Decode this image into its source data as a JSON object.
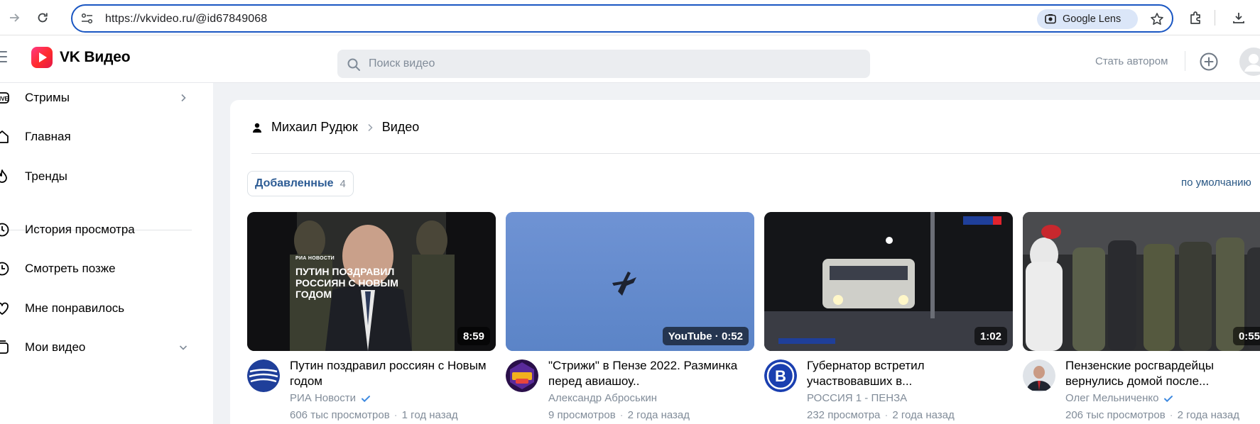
{
  "browser": {
    "url": "https://vkvideo.ru/@id67849068",
    "lens_label": "Google Lens",
    "icons": [
      "forward-icon",
      "reload-icon",
      "site-info-icon",
      "google-lens-icon",
      "bookmark-star-icon",
      "extensions-icon",
      "download-icon"
    ]
  },
  "header": {
    "logo_text": "VK Видео",
    "search_placeholder": "Поиск видео",
    "become_author": "Стать автором"
  },
  "sidebar": {
    "items": [
      {
        "label": "Стримы",
        "icon": "live-icon",
        "has_chevron": true
      },
      {
        "label": "Главная",
        "icon": "home-icon"
      },
      {
        "label": "Тренды",
        "icon": "trends-icon"
      },
      {
        "label": "История просмотра",
        "icon": "history-icon"
      },
      {
        "label": "Смотреть позже",
        "icon": "clock-icon"
      },
      {
        "label": "Мне понравилось",
        "icon": "heart-icon"
      },
      {
        "label": "Мои видео",
        "icon": "my-videos-icon",
        "has_chevron": true
      }
    ]
  },
  "main": {
    "breadcrumb": {
      "user": "Михаил Рудюк",
      "section": "Видео"
    },
    "tab": {
      "label": "Добавленные",
      "count": "4"
    },
    "sort_label": "по умолчанию",
    "videos": [
      {
        "thumb_caption_source": "РИА НОВОСТИ",
        "thumb_caption": "ПУТИН ПОЗДРАВИЛ РОССИЯН С НОВЫМ ГОДОМ",
        "duration": "8:59",
        "title": "Путин поздравил россиян с Новым годом",
        "channel": "РИА Новости",
        "verified": true,
        "views": "606 тыс просмотров",
        "age": "1 год назад"
      },
      {
        "duration": "YouTube · 0:52",
        "title": "\"Стрижи\" в Пензе 2022. Разминка перед авиашоу..",
        "channel": "Александр Аброськин",
        "verified": false,
        "views": "9 просмотров",
        "age": "2 года назад"
      },
      {
        "duration": "1:02",
        "title": "Губернатор встретил участвовавших в...",
        "channel": "РОССИЯ 1 - ПЕНЗА",
        "verified": false,
        "views": "232 просмотра",
        "age": "2 года назад"
      },
      {
        "duration": "0:55",
        "title": "Пензенские росгвардейцы вернулись домой после...",
        "channel": "Олег Мельниченко",
        "verified": true,
        "views": "206 тыс просмотров",
        "age": "2 года назад"
      }
    ]
  },
  "colors": {
    "address_border": "#1a56c2",
    "vk_red": "#ff2b2b",
    "link_blue": "#2a5885",
    "muted": "#818c99",
    "verified": "#3f8ae0"
  }
}
